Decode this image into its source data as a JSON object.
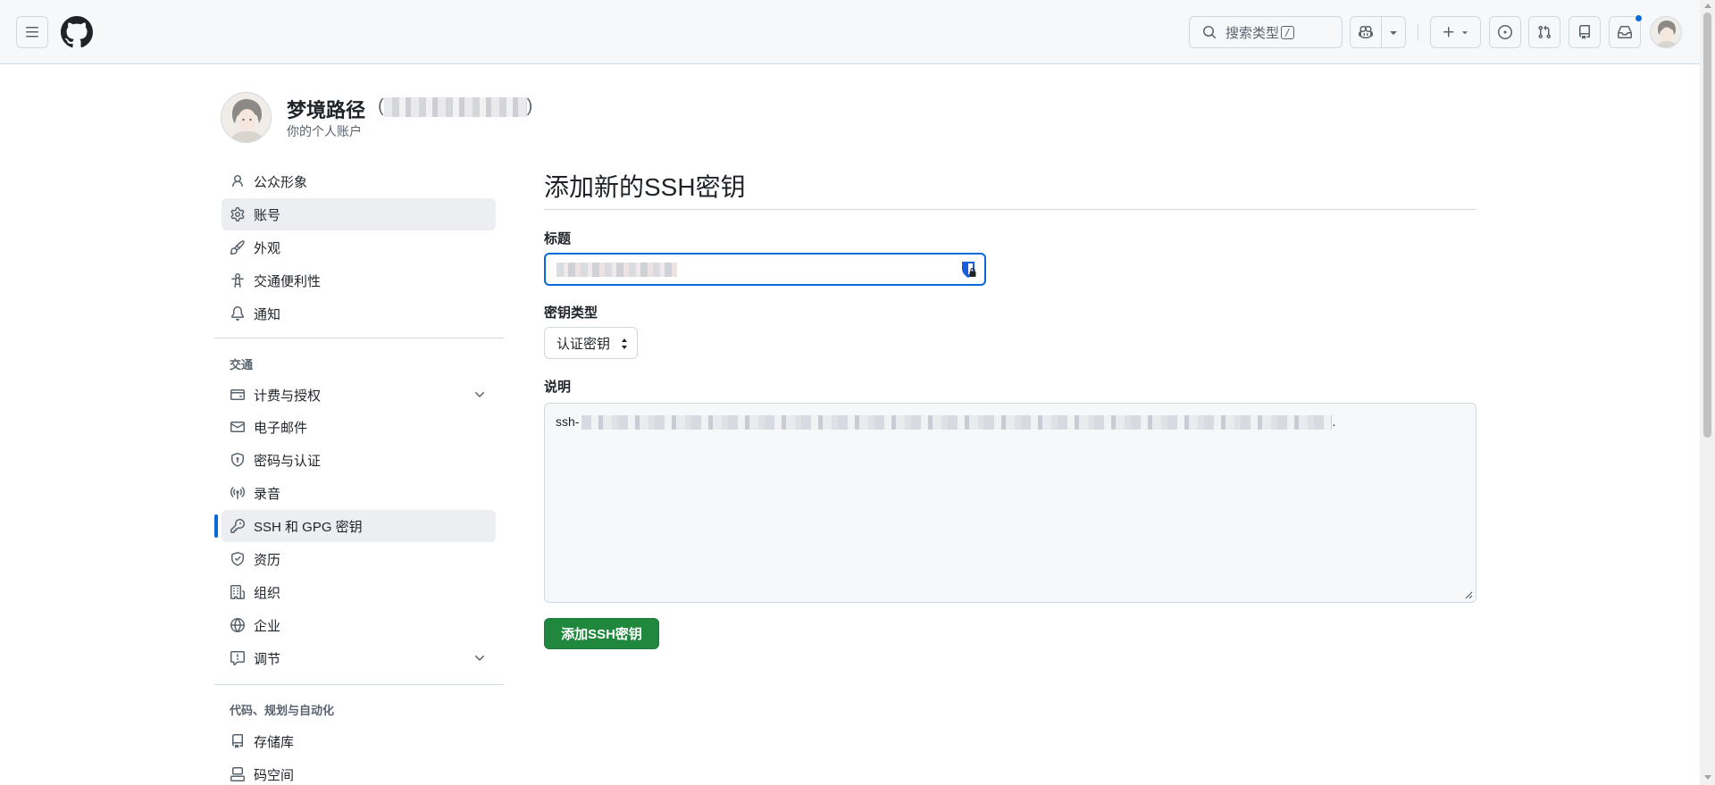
{
  "header": {
    "menu_icon": "three-bars-icon",
    "logo_icon": "github-mark-icon",
    "search_placeholder": "搜索类型",
    "search_shortcut": "/",
    "copilot_icon": "copilot-icon",
    "create_icon": "plus-icon",
    "issues_icon": "issue-opened-icon",
    "pulls_icon": "git-pull-request-icon",
    "repos_icon": "repo-icon",
    "inbox_icon": "inbox-icon",
    "avatar_icon": "user-avatar",
    "colors": {
      "accent": "#0969da",
      "header_bg": "#f6f8fa"
    }
  },
  "profile": {
    "display_name": "梦境路径",
    "login_open": "(",
    "login_close": ")",
    "subtitle": "你的个人账户"
  },
  "sidebar": {
    "items": [
      {
        "label": "公众形象",
        "icon": "person-icon"
      },
      {
        "label": "账号",
        "icon": "gear-icon"
      },
      {
        "label": "外观",
        "icon": "paintbrush-icon"
      },
      {
        "label": "交通便利性",
        "icon": "accessibility-icon"
      },
      {
        "label": "通知",
        "icon": "bell-icon"
      }
    ],
    "group_access": "交通",
    "access_items": [
      {
        "label": "计费与授权",
        "icon": "credit-card-icon",
        "expandable": true
      },
      {
        "label": "电子邮件",
        "icon": "mail-icon"
      },
      {
        "label": "密码与认证",
        "icon": "shield-lock-icon"
      },
      {
        "label": "录音",
        "icon": "broadcast-icon"
      },
      {
        "label": "SSH 和 GPG 密钥",
        "icon": "key-icon",
        "active": true
      },
      {
        "label": "资历",
        "icon": "shield-check-icon"
      },
      {
        "label": "组织",
        "icon": "organization-icon"
      },
      {
        "label": "企业",
        "icon": "globe-icon"
      },
      {
        "label": "调节",
        "icon": "report-icon",
        "expandable": true
      }
    ],
    "group_code": "代码、规划与自动化",
    "code_items": [
      {
        "label": "存储库",
        "icon": "repo-icon"
      },
      {
        "label": "码空间",
        "icon": "codespaces-icon"
      }
    ]
  },
  "main": {
    "title": "添加新的SSH密钥",
    "title_label": "标题",
    "key_type_label": "密钥类型",
    "key_type_value": "认证密钥",
    "key_label": "说明",
    "key_prefix": "ssh-",
    "key_suffix": ".",
    "submit_label": "添加SSH密钥",
    "colors": {
      "submit_bg": "#1f883d"
    }
  }
}
